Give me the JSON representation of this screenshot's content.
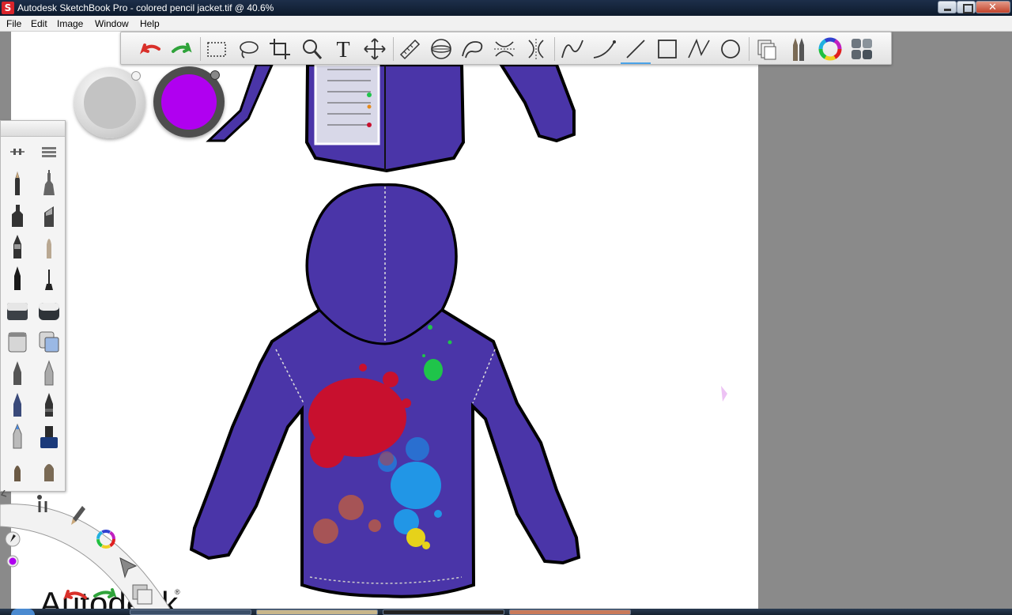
{
  "window": {
    "app_icon_letter": "S",
    "title": "Autodesk SketchBook Pro - colored pencil jacket.tif @ 40.6%"
  },
  "menu": [
    "File",
    "Edit",
    "Image",
    "Window",
    "Help"
  ],
  "toolbar": {
    "text_tool_glyph": "T"
  },
  "canvas": {
    "watermark": "Autodesk",
    "watermark_mark": "®"
  },
  "colors": {
    "jacket": "#4a35a8",
    "current_color": "#b000f0",
    "splat_red": "#c8102e",
    "splat_blue": "#2196e6",
    "splat_green": "#1fc44a",
    "splat_yellow": "#e6d21a",
    "splat_brown": "#b0584d",
    "canvas_bg": "#ffffff",
    "workspace_bg": "#8a8a8a"
  }
}
